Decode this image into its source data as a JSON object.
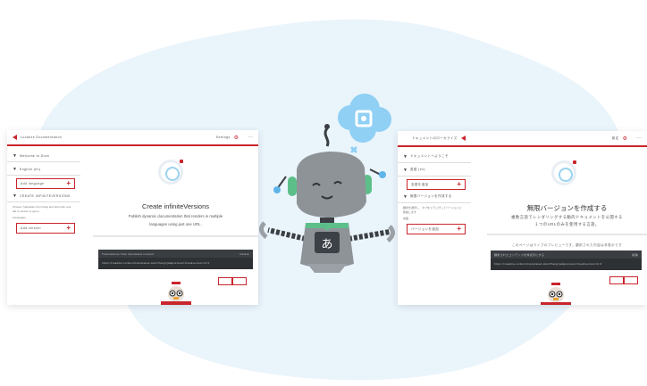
{
  "brand": {
    "accent": "#c9252c",
    "blob": "#eaf4fb",
    "robot_blue": "#7ec8f0"
  },
  "left_panel": {
    "header_text": "Localize Documentation",
    "header_right": "Settings",
    "sidebar": {
      "rows": [
        "Welcome to Docs",
        "English (en)"
      ],
      "add_language": "Add language",
      "section": "CREATE INFINITEVERSIONS",
      "desc": "Choose Translation from Drag and drop with your tab to version to get to",
      "subhead": "Languages",
      "add_version": "Add version"
    },
    "main": {
      "title": "Create infiniteVersions",
      "subtitle_line1": "Publish dynamic documentation that renders in multiple",
      "subtitle_line2": "languages using just one URL.",
      "bar_header": "Translations hide translated content",
      "bar_header_right": "Delete",
      "bar_body": "https://readme.io/docs/translated-docs?lang=ja&preview=true&version=2.0"
    }
  },
  "right_panel": {
    "header_text": "ドキュメントのローカライズ",
    "header_right": "設定",
    "sidebar": {
      "rows": [
        "ドキュメントへようこそ",
        "英語 (en)"
      ],
      "add_language": "言語を追加",
      "section": "無限バージョンを作成する",
      "desc": "翻訳を選択し、タブをドラッグしてバージョンに移動します",
      "subhead": "言語",
      "add_version": "バージョンを追加"
    },
    "main": {
      "title": "無限バージョンを作成する",
      "subtitle_line1": "複数言語でレンダリングする動的ドキュメントを公開する",
      "subtitle_line2": "１つのURLのみを使用する言語。",
      "note": "このページはライブのプレビューです。翻訳された内容は非表示です",
      "bar_header": "翻訳されたコンテンツを非表示にする",
      "bar_header_right": "削除",
      "bar_body": "https://readme.io/docs/translated-docs?lang=ja&preview=true&version=2.0"
    }
  },
  "robot": {
    "screen_glyph": "あ"
  }
}
